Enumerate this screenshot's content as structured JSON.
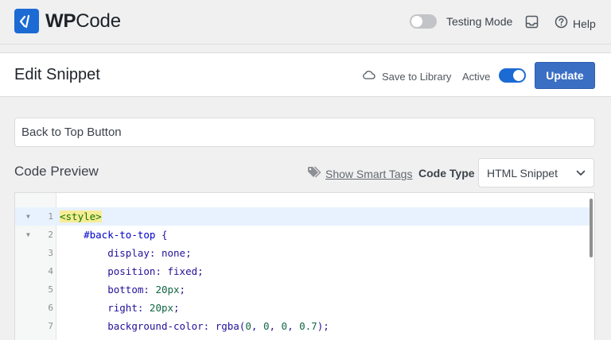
{
  "app": {
    "brand_prefix": "WP",
    "brand_suffix": "Code",
    "testing_mode_label": "Testing Mode",
    "testing_mode_on": false,
    "help_label": "Help"
  },
  "header": {
    "title": "Edit Snippet",
    "save_to_library_label": "Save to Library",
    "active_label": "Active",
    "active_on": true,
    "update_label": "Update"
  },
  "snippet": {
    "title_value": "Back to Top Button"
  },
  "code_section": {
    "label": "Code Preview",
    "smart_tags_label": "Show Smart Tags",
    "code_type_label": "Code Type",
    "code_type_value": "HTML Snippet"
  },
  "code_lines": [
    {
      "n": "1",
      "text": "<style>"
    },
    {
      "n": "2",
      "text": "    #back-to-top {"
    },
    {
      "n": "3",
      "text": "        display: none;"
    },
    {
      "n": "4",
      "text": "        position: fixed;"
    },
    {
      "n": "5",
      "text": "        bottom: 20px;"
    },
    {
      "n": "6",
      "text": "        right: 20px;"
    },
    {
      "n": "7",
      "text": "        background-color: rgba(0, 0, 0, 0.7);"
    }
  ],
  "colors": {
    "accent": "#1c6ad3",
    "update_button": "#3b6fc4",
    "active_line": "#e8f2ff"
  },
  "icons": {
    "logo": "code-brackets-icon",
    "inbox": "inbox-icon",
    "help": "help-circle-icon",
    "cloud": "cloud-icon",
    "tag": "tag-icon",
    "chevron": "chevron-down-icon"
  }
}
